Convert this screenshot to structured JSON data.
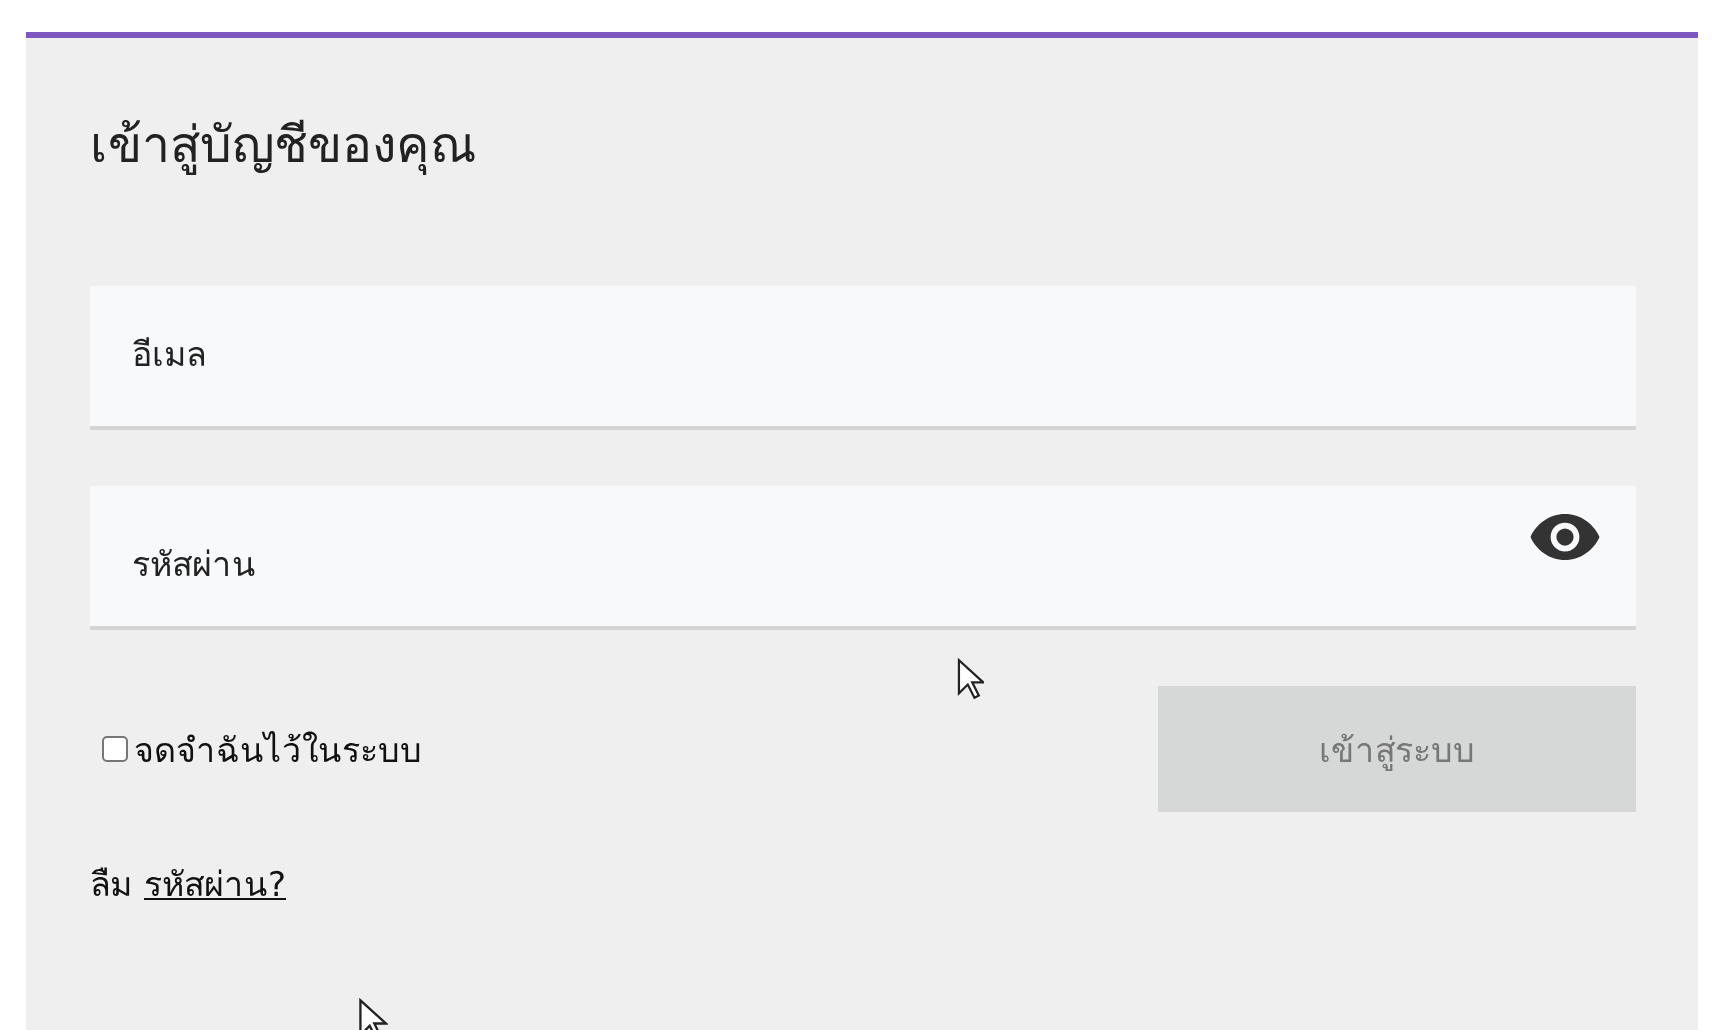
{
  "title": "เข้าสู่บัญชีของคุณ",
  "fields": [
    {
      "kind": "email",
      "placeholder": "อีเมล"
    },
    {
      "kind": "password",
      "placeholder": "รหัสผ่าน"
    }
  ],
  "remember": {
    "label": "จดจำฉันไว้ในระบบ",
    "checked": false
  },
  "login_button": {
    "label": "เข้าสู่ระบบ",
    "disabled": true
  },
  "forgot": {
    "text": "ลืม",
    "link": "รหัสผ่าน?"
  }
}
